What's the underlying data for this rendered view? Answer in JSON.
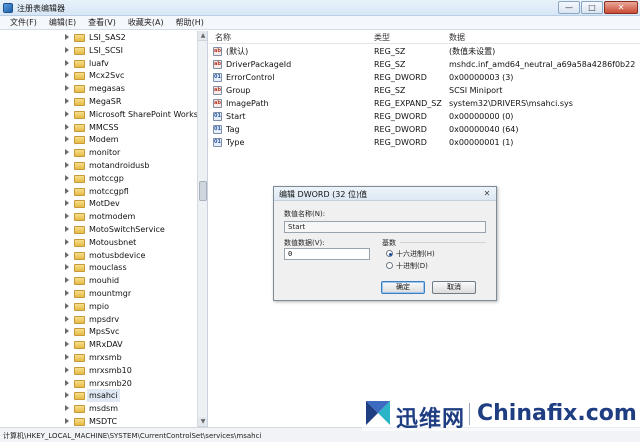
{
  "window": {
    "title": "注册表编辑器",
    "btn_min": "—",
    "btn_max": "□",
    "btn_close": "✕"
  },
  "menu": [
    "文件(F)",
    "编辑(E)",
    "查看(V)",
    "收藏夹(A)",
    "帮助(H)"
  ],
  "tree": {
    "items": [
      "LSI_SAS2",
      "LSI_SCSI",
      "luafv",
      "Mcx2Svc",
      "megasas",
      "MegaSR",
      "Microsoft SharePoint Workspa",
      "MMCSS",
      "Modem",
      "monitor",
      "motandroidusb",
      "motccgp",
      "motccgpfl",
      "MotDev",
      "motmodem",
      "MotoSwitchService",
      "Motousbnet",
      "motusbdevice",
      "mouclass",
      "mouhid",
      "mountmgr",
      "mpio",
      "mpsdrv",
      "MpsSvc",
      "MRxDAV",
      "mrxsmb",
      "mrxsmb10",
      "mrxsmb20",
      "msahci",
      "msdsm",
      "MSDTC"
    ],
    "selected": "msahci"
  },
  "list": {
    "headers": {
      "name": "名称",
      "type": "类型",
      "data": "数据"
    },
    "rows": [
      {
        "icon": "ab",
        "name": "(默认)",
        "type": "REG_SZ",
        "data": "(数值未设置)"
      },
      {
        "icon": "ab",
        "name": "DriverPackageId",
        "type": "REG_SZ",
        "data": "mshdc.inf_amd64_neutral_a69a58a4286f0b22"
      },
      {
        "icon": "bin",
        "name": "ErrorControl",
        "type": "REG_DWORD",
        "data": "0x00000003 (3)"
      },
      {
        "icon": "ab",
        "name": "Group",
        "type": "REG_SZ",
        "data": "SCSI Miniport"
      },
      {
        "icon": "ab",
        "name": "ImagePath",
        "type": "REG_EXPAND_SZ",
        "data": "system32\\DRIVERS\\msahci.sys"
      },
      {
        "icon": "bin",
        "name": "Start",
        "type": "REG_DWORD",
        "data": "0x00000000 (0)"
      },
      {
        "icon": "bin",
        "name": "Tag",
        "type": "REG_DWORD",
        "data": "0x00000040 (64)"
      },
      {
        "icon": "bin",
        "name": "Type",
        "type": "REG_DWORD",
        "data": "0x00000001 (1)"
      }
    ]
  },
  "dialog": {
    "title": "编辑 DWORD (32 位)值",
    "close": "✕",
    "value_name_label": "数值名称(N):",
    "value_name": "Start",
    "value_data_label": "数值数据(V):",
    "value_data": "0",
    "base_label": "基数",
    "hex_label": "十六进制(H)",
    "dec_label": "十进制(D)",
    "hex_selected": true,
    "ok": "确定",
    "cancel": "取消"
  },
  "status": "计算机\\HKEY_LOCAL_MACHINE\\SYSTEM\\CurrentControlSet\\services\\msahci",
  "watermark": {
    "cn": "迅维网",
    "en": "Chinafix.com"
  },
  "icons": {
    "value_string": "ab-icon",
    "value_binary": "binary-value-icon",
    "folder": "folder-icon"
  }
}
